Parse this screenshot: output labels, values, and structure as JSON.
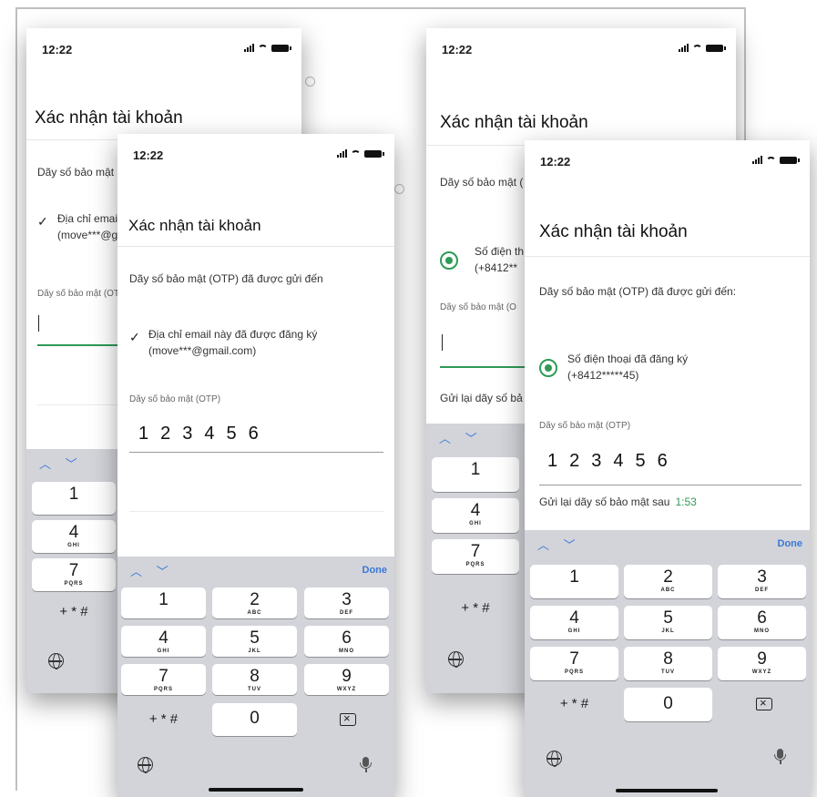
{
  "status": {
    "time": "12:22"
  },
  "title": "Xác nhận tài khoản",
  "otp_sent_short": "Dãy số bảo mật (",
  "otp_sent_full": "Dãy số bảo mật (OTP) đã được gửi đến",
  "otp_sent_colon": "Dãy số bảo mật (OTP) đã được gửi đến:",
  "email_line1_trunc": "Địa chỉ emai",
  "email_line2_trunc": "(move***@g",
  "email_line1": "Địa chỉ email này đã được đăng ký",
  "email_line2": "(move***@gmail.com)",
  "phone_line1_trunc": "Số điện th",
  "phone_line2_trunc": "(+8412**",
  "phone_line1": "Số điện thoại đã đăng ký",
  "phone_line2": "(+8412*****45)",
  "otp_label_trunc": "Dãy số bảo mật (OT",
  "otp_label_trunc2": "Dãy số bảo mật (O",
  "otp_label": "Dãy số bảo mật (OTP)",
  "otp_value": "123456",
  "resend_trunc": "Gửi lại dãy số bả",
  "resend_label": "Gửi lại dãy số bảo mật sau",
  "resend_timer": "1:53",
  "check_icon": "check-icon",
  "keyboard": {
    "done": "Done",
    "arrows": "^ v",
    "symbols": "+ * #",
    "keys": [
      {
        "n": "1",
        "l": ""
      },
      {
        "n": "2",
        "l": "ABC"
      },
      {
        "n": "3",
        "l": "DEF"
      },
      {
        "n": "4",
        "l": "GHI"
      },
      {
        "n": "5",
        "l": "JKL"
      },
      {
        "n": "6",
        "l": "MNO"
      },
      {
        "n": "7",
        "l": "PQRS"
      },
      {
        "n": "8",
        "l": "TUV"
      },
      {
        "n": "9",
        "l": "WXYZ"
      },
      {
        "n": "0",
        "l": ""
      }
    ]
  },
  "colors": {
    "accent_green": "#2f9a57",
    "ios_blue": "#3b78d8",
    "keyboard_bg": "#d2d4d9"
  }
}
